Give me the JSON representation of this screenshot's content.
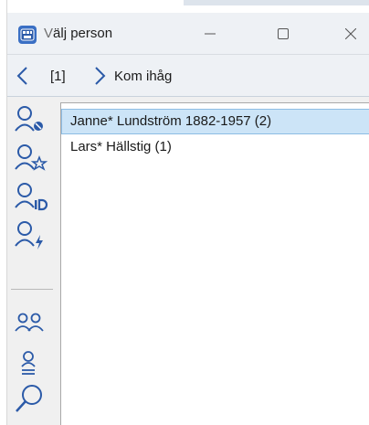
{
  "window": {
    "title": "Välj person",
    "title_accel_char": "V",
    "title_rest": "älj person",
    "controls": [
      "minimize-icon",
      "maximize-icon",
      "close-icon"
    ]
  },
  "nav": {
    "back_icon": "chevron-left-icon",
    "index": "[1]",
    "forward_icon": "chevron-right-icon",
    "label": "Kom ihåg"
  },
  "toolbar": {
    "buttons": [
      "person-remove-icon",
      "person-star-icon",
      "person-id-icon",
      "person-flash-icon",
      "persons-group-icon",
      "person-list-icon",
      "search-icon"
    ]
  },
  "people": [
    {
      "label": "Janne* Lundström 1882-1957 (2)",
      "selected": true
    },
    {
      "label": "Lars* Hällstig  (1)",
      "selected": false
    }
  ],
  "colors": {
    "accent": "#3a6fc4",
    "icon_blue": "#2b5aa8",
    "selection": "#cce4f7",
    "selection_border": "#8dbde4"
  }
}
